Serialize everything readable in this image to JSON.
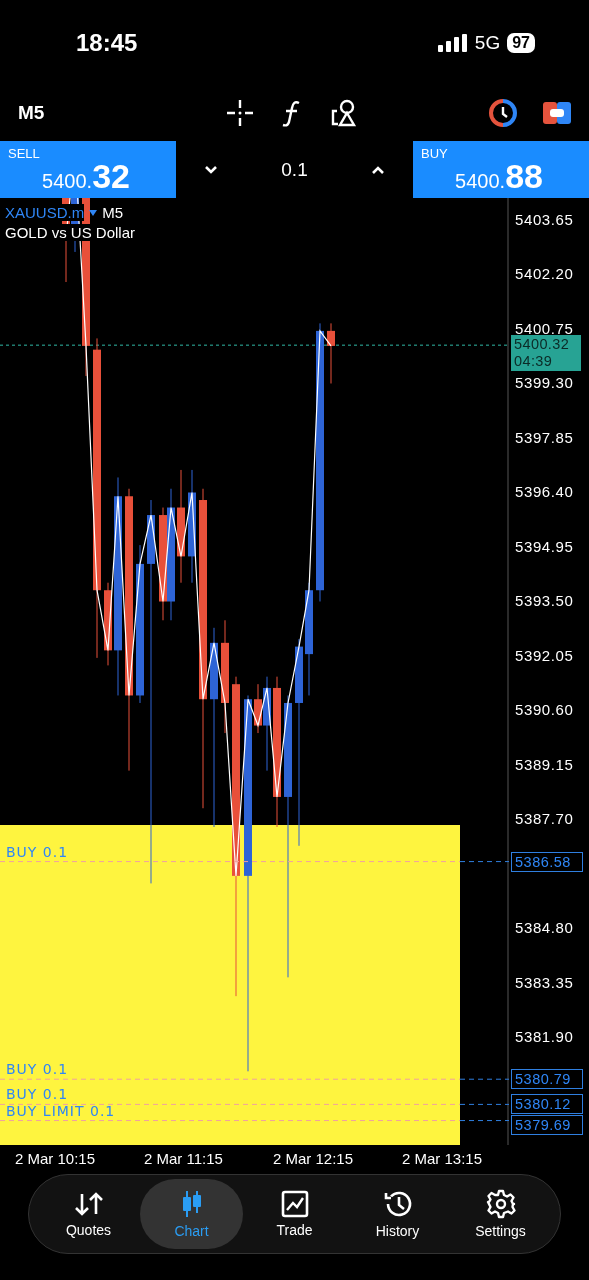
{
  "status_bar": {
    "time": "18:45",
    "network": "5G",
    "battery": "97"
  },
  "toolbar": {
    "timeframe": "M5"
  },
  "trade_bar": {
    "sell": {
      "label": "SELL",
      "price_small": "5400.",
      "price_big": "32"
    },
    "volume": "0.1",
    "buy": {
      "label": "BUY",
      "price_small": "5400.",
      "price_big": "88"
    }
  },
  "chart": {
    "symbol": "XAUUSD.m",
    "timeframe": "M5",
    "description": "GOLD vs US Dollar",
    "price_labels": [
      "5403.65",
      "5402.20",
      "5400.75",
      "5399.30",
      "5397.85",
      "5396.40",
      "5394.95",
      "5393.50",
      "5392.05",
      "5390.60",
      "5389.15",
      "5387.70",
      "5384.80",
      "5383.35",
      "5381.90"
    ],
    "current_price": "5400.32",
    "countdown": "04:39",
    "orders": [
      {
        "label": "BUY 0.1",
        "price": "5386.58"
      },
      {
        "label": "BUY 0.1",
        "price": "5380.79"
      },
      {
        "label": "BUY 0.1",
        "price": "5380.12"
      },
      {
        "label": "BUY LIMIT 0.1",
        "price": "5379.69"
      }
    ],
    "time_labels": [
      "2 Mar 10:15",
      "2 Mar 11:15",
      "2 Mar 12:15",
      "2 Mar 13:15"
    ]
  },
  "nav": [
    {
      "kind": "quotes",
      "label": "Quotes",
      "selected": false
    },
    {
      "kind": "chart",
      "label": "Chart",
      "selected": true
    },
    {
      "kind": "trade",
      "label": "Trade",
      "selected": false
    },
    {
      "kind": "history",
      "label": "History",
      "selected": false
    },
    {
      "kind": "settings",
      "label": "Settings",
      "selected": false
    }
  ]
}
